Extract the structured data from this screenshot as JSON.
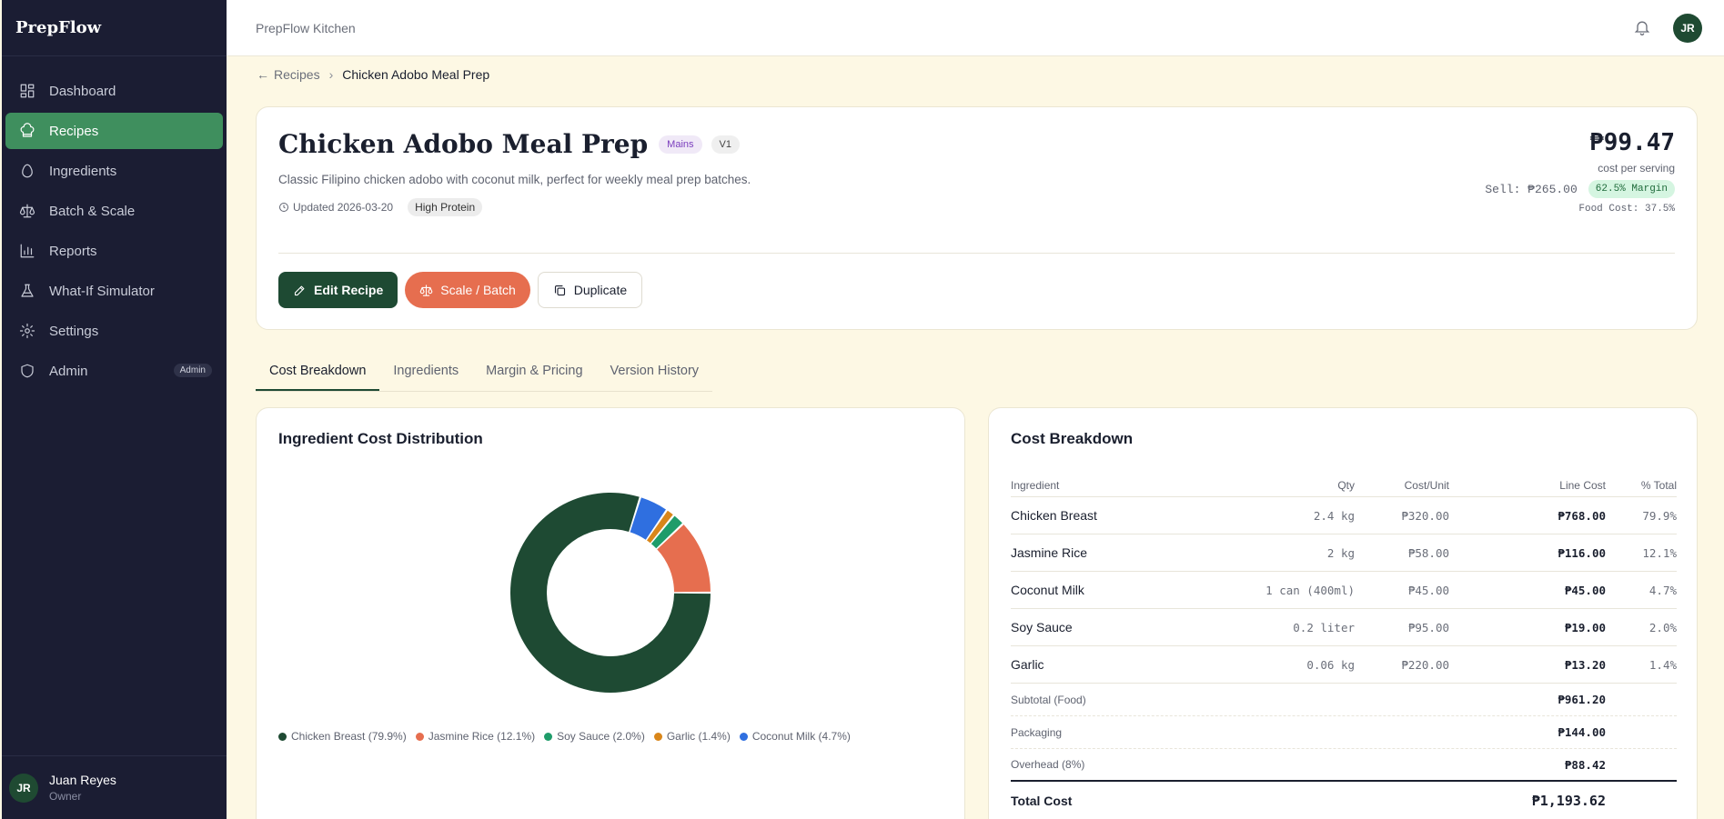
{
  "app": {
    "brand": "PrepFlow",
    "org": "PrepFlow Kitchen"
  },
  "sidebar": {
    "items": [
      {
        "label": "Dashboard",
        "icon": "dashboard-icon"
      },
      {
        "label": "Recipes",
        "icon": "chef-hat-icon",
        "active": true
      },
      {
        "label": "Ingredients",
        "icon": "egg-icon"
      },
      {
        "label": "Batch & Scale",
        "icon": "scale-icon"
      },
      {
        "label": "Reports",
        "icon": "bar-chart-icon"
      },
      {
        "label": "What-If Simulator",
        "icon": "flask-icon"
      },
      {
        "label": "Settings",
        "icon": "gear-icon"
      },
      {
        "label": "Admin",
        "icon": "shield-icon",
        "badge": "Admin"
      }
    ],
    "user": {
      "initials": "JR",
      "name": "Juan Reyes",
      "role": "Owner"
    }
  },
  "topbar": {
    "avatar_initials": "JR"
  },
  "breadcrumb": {
    "parent": "Recipes",
    "current": "Chicken Adobo Meal Prep"
  },
  "recipe": {
    "title": "Chicken Adobo Meal Prep",
    "category": "Mains",
    "version": "V1",
    "description": "Classic Filipino chicken adobo with coconut milk, perfect for weekly meal prep batches.",
    "updated": "Updated 2026-03-20",
    "tag": "High Protein",
    "cost_per_serving": "₱99.47",
    "cost_label": "cost per serving",
    "sell": "Sell: ₱265.00",
    "margin": "62.5% Margin",
    "food_cost": "Food Cost: 37.5%"
  },
  "actions": {
    "edit": "Edit Recipe",
    "scale": "Scale / Batch",
    "duplicate": "Duplicate"
  },
  "tabs": [
    "Cost Breakdown",
    "Ingredients",
    "Margin & Pricing",
    "Version History"
  ],
  "chart_card": {
    "title": "Ingredient Cost Distribution"
  },
  "chart_data": {
    "type": "pie",
    "categories": [
      "Chicken Breast",
      "Coconut Milk",
      "Garlic",
      "Soy Sauce",
      "Jasmine Rice"
    ],
    "values": [
      79.9,
      4.7,
      1.4,
      2.0,
      12.1
    ],
    "colors": [
      "#1e4a33",
      "#2f6fe0",
      "#d9861a",
      "#1f9c6a",
      "#e66e4f"
    ],
    "legend": [
      {
        "label": "Chicken Breast (79.9%)",
        "color": "#1e4a33"
      },
      {
        "label": "Jasmine Rice (12.1%)",
        "color": "#e66e4f"
      },
      {
        "label": "Soy Sauce (2.0%)",
        "color": "#1f9c6a"
      },
      {
        "label": "Garlic (1.4%)",
        "color": "#d9861a"
      },
      {
        "label": "Coconut Milk (4.7%)",
        "color": "#2f6fe0"
      }
    ],
    "legend_position": "bottom"
  },
  "table": {
    "title": "Cost Breakdown",
    "headers": [
      "Ingredient",
      "Qty",
      "Cost/Unit",
      "Line Cost",
      "% Total"
    ],
    "rows": [
      {
        "name": "Chicken Breast",
        "qty": "2.4 kg",
        "unit": "₱320.00",
        "line": "₱768.00",
        "pct": "79.9%"
      },
      {
        "name": "Jasmine Rice",
        "qty": "2 kg",
        "unit": "₱58.00",
        "line": "₱116.00",
        "pct": "12.1%"
      },
      {
        "name": "Coconut Milk",
        "qty": "1 can (400ml)",
        "unit": "₱45.00",
        "line": "₱45.00",
        "pct": "4.7%"
      },
      {
        "name": "Soy Sauce",
        "qty": "0.2 liter",
        "unit": "₱95.00",
        "line": "₱19.00",
        "pct": "2.0%"
      },
      {
        "name": "Garlic",
        "qty": "0.06 kg",
        "unit": "₱220.00",
        "line": "₱13.20",
        "pct": "1.4%"
      }
    ],
    "subtotal": {
      "label": "Subtotal (Food)",
      "value": "₱961.20"
    },
    "packaging": {
      "label": "Packaging",
      "value": "₱144.00"
    },
    "overhead": {
      "label": "Overhead (8%)",
      "value": "₱88.42"
    },
    "total": {
      "label": "Total Cost",
      "value": "₱1,193.62"
    }
  },
  "colors": {
    "sidebar_bg": "#1b1d33",
    "active_nav": "#3f8f5e",
    "primary": "#1e4a33",
    "accent": "#e66e4f",
    "page_bg": "#fdf8e4"
  }
}
